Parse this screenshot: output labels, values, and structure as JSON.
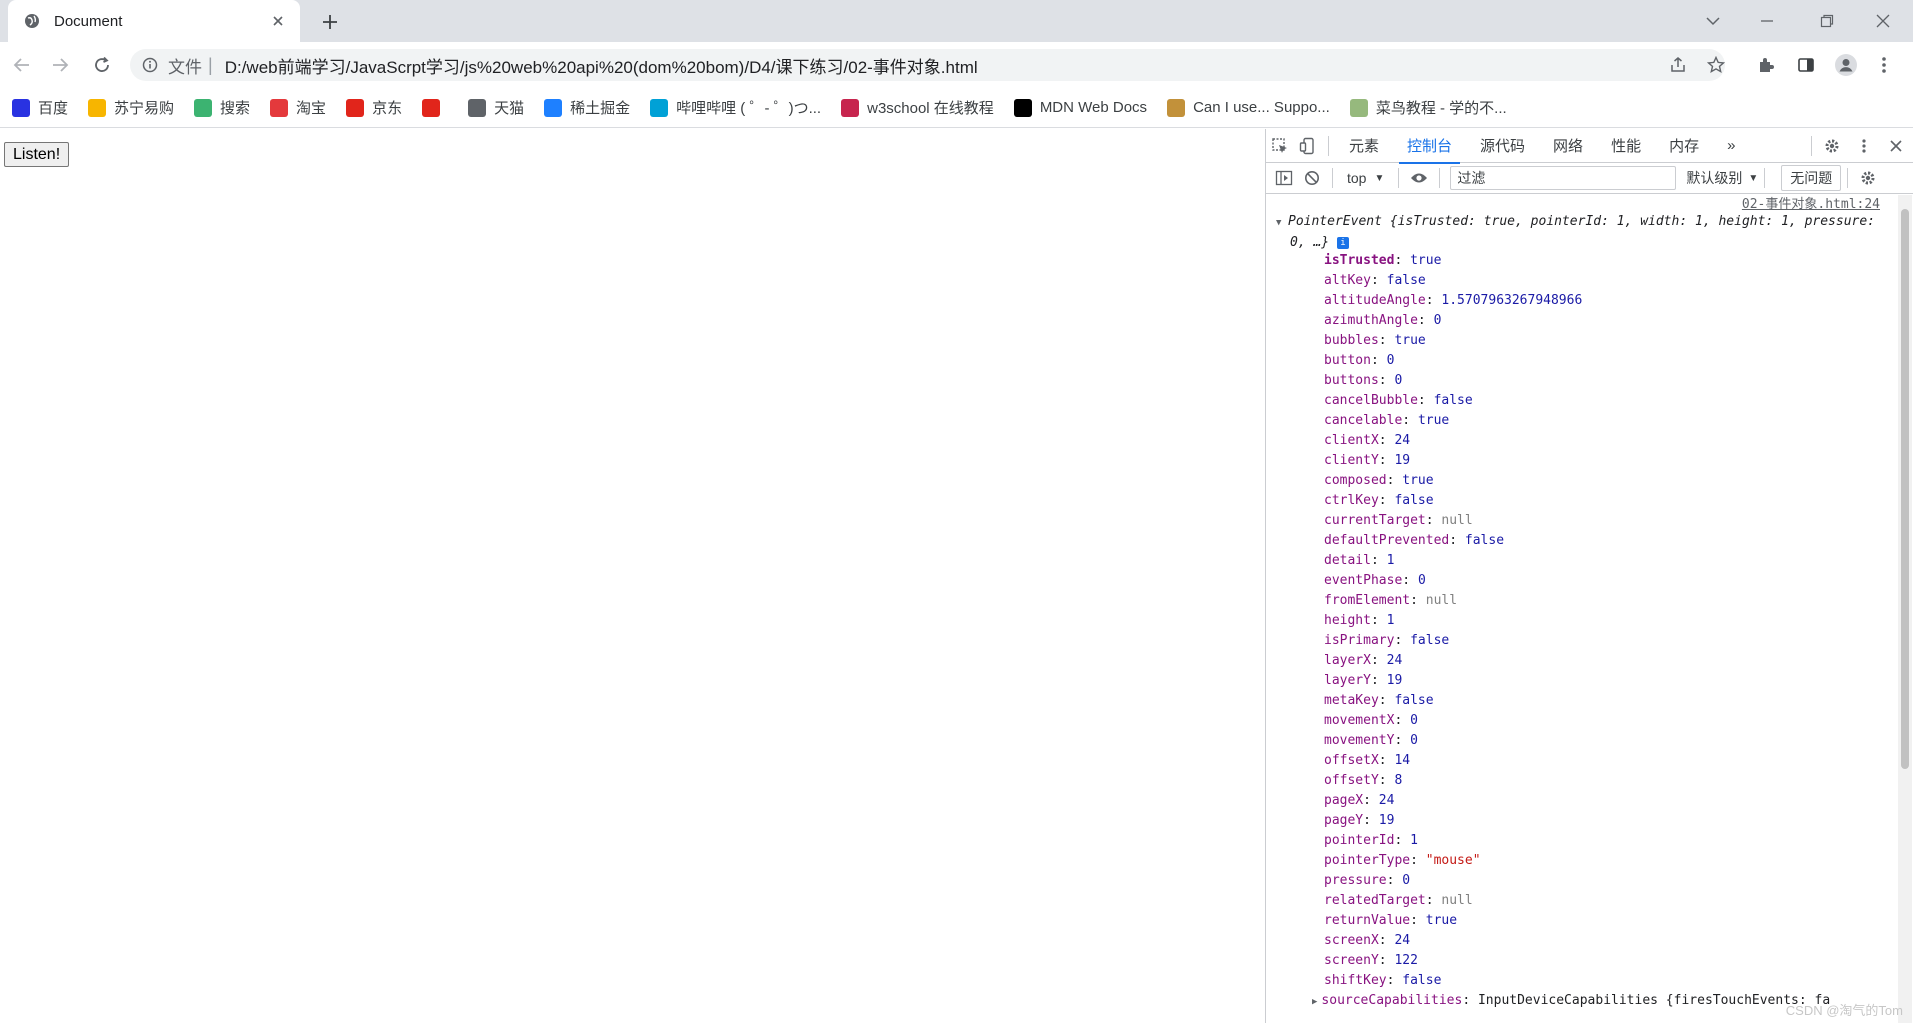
{
  "tab": {
    "title": "Document"
  },
  "toolbar": {
    "scheme": "文件",
    "separator": "|",
    "url": "D:/web前端学习/JavaScrpt学习/js%20web%20api%20(dom%20bom)/D4/课下练习/02-事件对象.html"
  },
  "bookmarks": [
    {
      "label": "百度",
      "icon": "baidu-icon",
      "color": "#2932e1"
    },
    {
      "label": "苏宁易购",
      "icon": "suning-icon",
      "color": "#f7b500"
    },
    {
      "label": "搜索",
      "icon": "ie-search-icon",
      "color": "#3cb371"
    },
    {
      "label": "淘宝",
      "icon": "taobao-icon",
      "color": "#e4393c"
    },
    {
      "label": "京东",
      "icon": "jd-icon",
      "color": "#e1251b"
    },
    {
      "label": "",
      "icon": "grid-logo-icon",
      "color": "#e1251b"
    },
    {
      "label": "天猫",
      "icon": "globe-icon",
      "color": "#5f6368"
    },
    {
      "label": "稀土掘金",
      "icon": "juejin-icon",
      "color": "#1e80ff"
    },
    {
      "label": "哔哩哔哩 ( ゜- ゜)つ...",
      "icon": "bilibili-icon",
      "color": "#00a1d6"
    },
    {
      "label": "w3school 在线教程",
      "icon": "w3school-icon",
      "color": "#c7254e"
    },
    {
      "label": "MDN Web Docs",
      "icon": "mdn-icon",
      "color": "#000000"
    },
    {
      "label": "Can I use... Suppo...",
      "icon": "caniuse-icon",
      "color": "#c2913a"
    },
    {
      "label": "菜鸟教程 - 学的不...",
      "icon": "runoob-icon",
      "color": "#96b97d"
    }
  ],
  "page": {
    "button_label": "Listen!"
  },
  "devtools": {
    "tabs": [
      "元素",
      "控制台",
      "源代码",
      "网络",
      "性能",
      "内存"
    ],
    "active_tab": "控制台",
    "context": "top",
    "filter_placeholder": "过滤",
    "level": "默认级别",
    "issues": "无问题",
    "source_link": "02-事件对象.html:24",
    "object_header": {
      "type": "PointerEvent",
      "preview": "{isTrusted: true, pointerId: 1, width: 1, height: 1, pressure: 0, …}"
    },
    "properties": [
      {
        "k": "isTrusted",
        "v": "true",
        "t": "bool",
        "own": true
      },
      {
        "k": "altKey",
        "v": "false",
        "t": "bool"
      },
      {
        "k": "altitudeAngle",
        "v": "1.5707963267948966",
        "t": "num"
      },
      {
        "k": "azimuthAngle",
        "v": "0",
        "t": "num"
      },
      {
        "k": "bubbles",
        "v": "true",
        "t": "bool"
      },
      {
        "k": "button",
        "v": "0",
        "t": "num"
      },
      {
        "k": "buttons",
        "v": "0",
        "t": "num"
      },
      {
        "k": "cancelBubble",
        "v": "false",
        "t": "bool"
      },
      {
        "k": "cancelable",
        "v": "true",
        "t": "bool"
      },
      {
        "k": "clientX",
        "v": "24",
        "t": "num"
      },
      {
        "k": "clientY",
        "v": "19",
        "t": "num"
      },
      {
        "k": "composed",
        "v": "true",
        "t": "bool"
      },
      {
        "k": "ctrlKey",
        "v": "false",
        "t": "bool"
      },
      {
        "k": "currentTarget",
        "v": "null",
        "t": "null"
      },
      {
        "k": "defaultPrevented",
        "v": "false",
        "t": "bool"
      },
      {
        "k": "detail",
        "v": "1",
        "t": "num"
      },
      {
        "k": "eventPhase",
        "v": "0",
        "t": "num"
      },
      {
        "k": "fromElement",
        "v": "null",
        "t": "null"
      },
      {
        "k": "height",
        "v": "1",
        "t": "num"
      },
      {
        "k": "isPrimary",
        "v": "false",
        "t": "bool"
      },
      {
        "k": "layerX",
        "v": "24",
        "t": "num"
      },
      {
        "k": "layerY",
        "v": "19",
        "t": "num"
      },
      {
        "k": "metaKey",
        "v": "false",
        "t": "bool"
      },
      {
        "k": "movementX",
        "v": "0",
        "t": "num"
      },
      {
        "k": "movementY",
        "v": "0",
        "t": "num"
      },
      {
        "k": "offsetX",
        "v": "14",
        "t": "num"
      },
      {
        "k": "offsetY",
        "v": "8",
        "t": "num"
      },
      {
        "k": "pageX",
        "v": "24",
        "t": "num"
      },
      {
        "k": "pageY",
        "v": "19",
        "t": "num"
      },
      {
        "k": "pointerId",
        "v": "1",
        "t": "num"
      },
      {
        "k": "pointerType",
        "v": "\"mouse\"",
        "t": "str"
      },
      {
        "k": "pressure",
        "v": "0",
        "t": "num"
      },
      {
        "k": "relatedTarget",
        "v": "null",
        "t": "null"
      },
      {
        "k": "returnValue",
        "v": "true",
        "t": "bool"
      },
      {
        "k": "screenX",
        "v": "24",
        "t": "num"
      },
      {
        "k": "screenY",
        "v": "122",
        "t": "num"
      },
      {
        "k": "shiftKey",
        "v": "false",
        "t": "bool"
      },
      {
        "k": "sourceCapabilities",
        "v": "InputDeviceCapabilities {firesTouchEvents: fa",
        "t": "obj",
        "collapsed": true
      }
    ],
    "watermark": "CSDN @淘气的Tom"
  }
}
